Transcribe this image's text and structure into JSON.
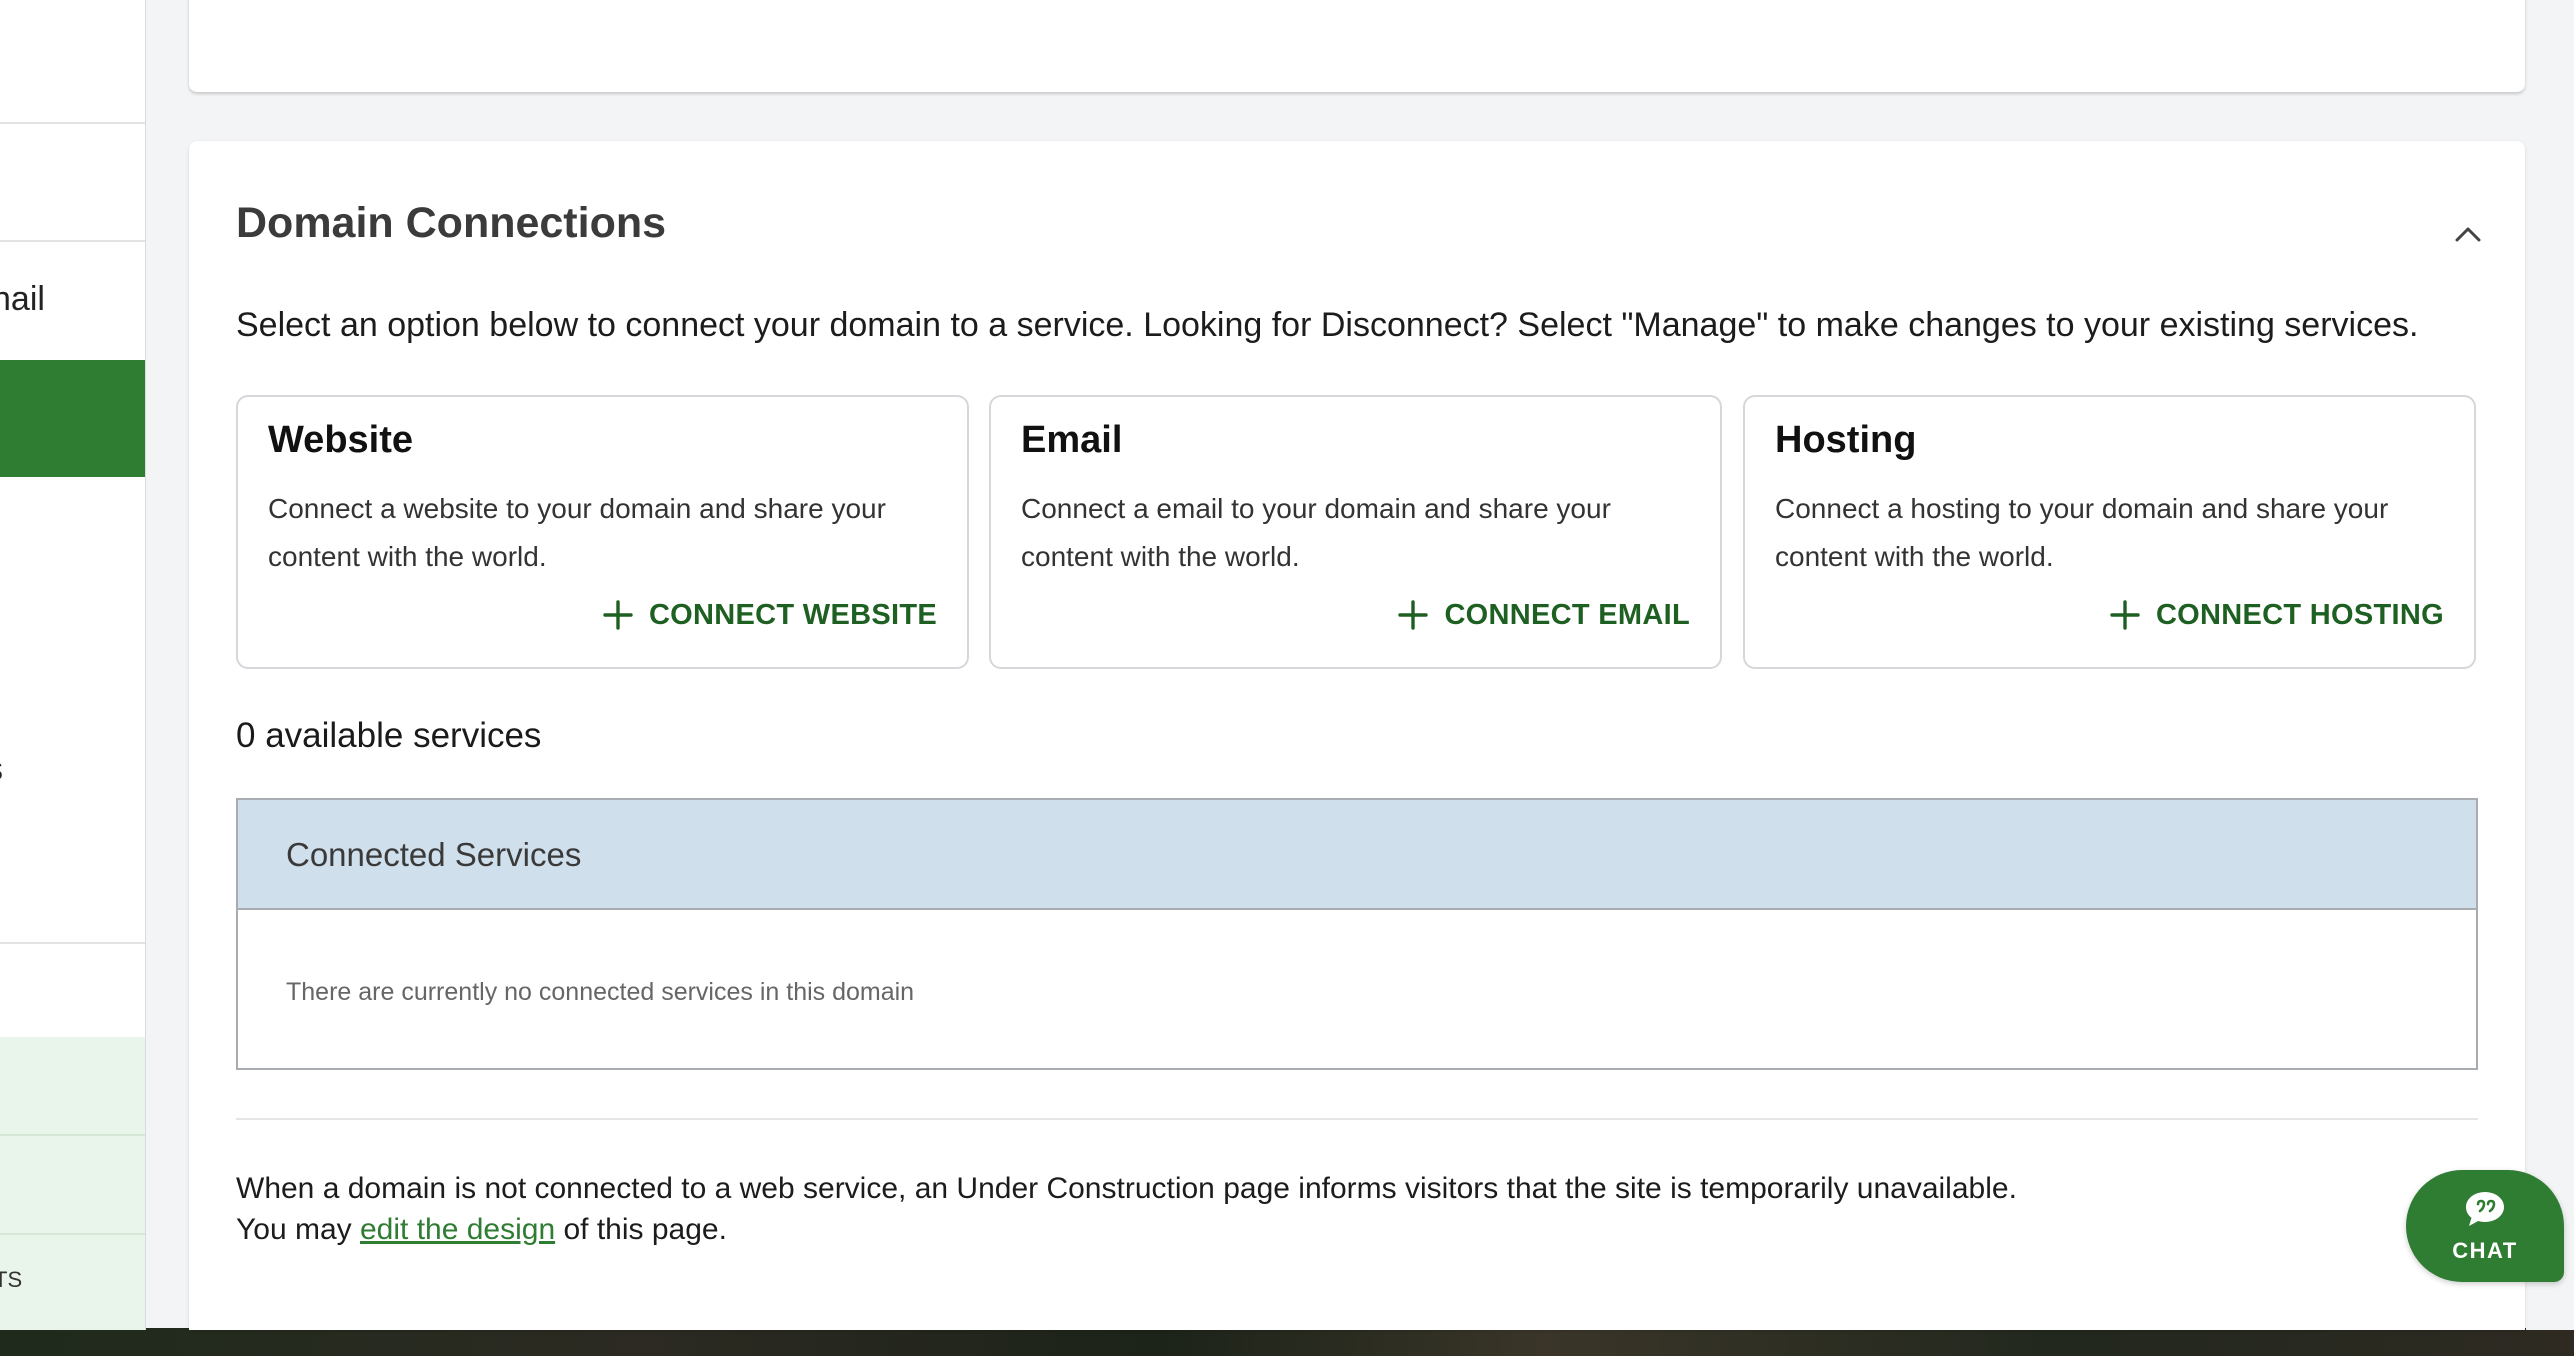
{
  "sidebar": {
    "partial_item_mail": "nail",
    "partial_item_s": "s",
    "partial_item_ts": "TS"
  },
  "domain_connections": {
    "title": "Domain Connections",
    "intro": "Select an option below to connect your domain to a service. Looking for Disconnect? Select \"Manage\" to make changes to your existing services.",
    "services": [
      {
        "title": "Website",
        "description": "Connect a website to your domain and share your content with the world.",
        "button_label": "CONNECT WEBSITE"
      },
      {
        "title": "Email",
        "description": "Connect a email to your domain and share your content with the world.",
        "button_label": "CONNECT EMAIL"
      },
      {
        "title": "Hosting",
        "description": "Connect a hosting to your domain and share your content with the world.",
        "button_label": "CONNECT HOSTING"
      }
    ],
    "available_count": "0 available services",
    "connected_table": {
      "header": "Connected Services",
      "empty_message": "There are currently no connected services in this domain"
    },
    "footnote": {
      "line1": "When a domain is not connected to a web service, an Under Construction page informs visitors that the site is temporarily unavailable.",
      "line2_before": "You may",
      "link": "edit the design",
      "line2_after": "of this page."
    }
  },
  "chat": {
    "label": "CHAT"
  },
  "colors": {
    "brand_green": "#2e7d32",
    "button_text_green": "#1e5f22",
    "table_header_blue": "#cfdfec",
    "sidebar_light_green": "#e9f4ea"
  },
  "icons": [
    "chevron-up-icon",
    "plus-icon",
    "chat-bubble-icon"
  ]
}
